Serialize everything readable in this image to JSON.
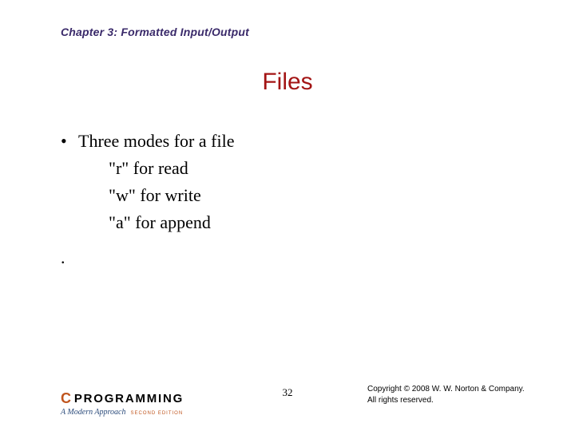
{
  "chapter": "Chapter 3: Formatted Input/Output",
  "title": "Files",
  "bullet": {
    "marker": "•",
    "text": "Three modes for a file"
  },
  "sub_items": [
    "\"r\" for read",
    "\"w\" for write",
    "\"a\" for append"
  ],
  "lonely_dot": ".",
  "page_number": "32",
  "logo": {
    "c": "C",
    "word": "PROGRAMMING",
    "subtitle": "A Modern Approach",
    "edition": "SECOND EDITION"
  },
  "copyright": {
    "line1": "Copyright © 2008 W. W. Norton & Company.",
    "line2": "All rights reserved."
  }
}
